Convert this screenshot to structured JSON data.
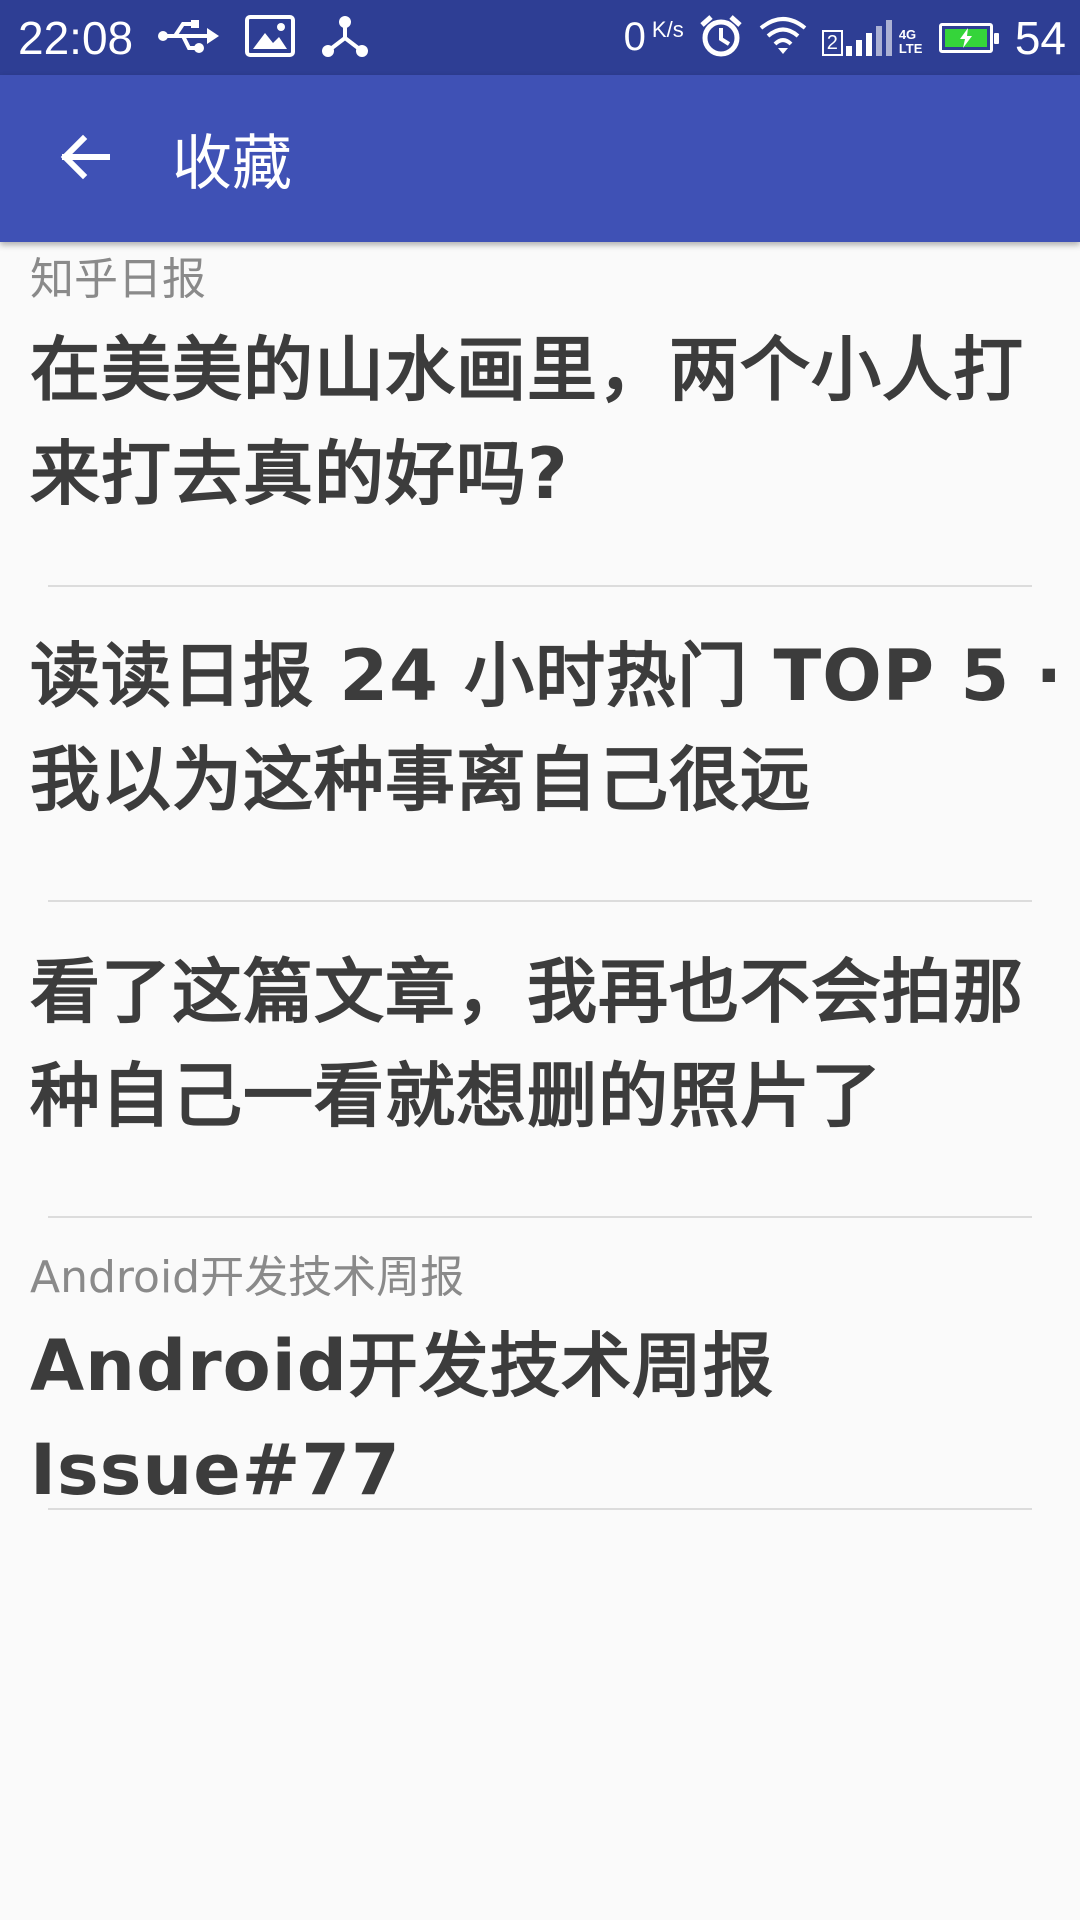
{
  "status_bar": {
    "time": "22:08",
    "speed_value": "0",
    "speed_unit": "K/s",
    "sim_label": "2",
    "network": "4G LTE",
    "battery_percent": "54",
    "icons": [
      "usb-icon",
      "image-icon",
      "share-network-icon",
      "alarm-icon",
      "wifi-icon",
      "signal-icon",
      "battery-charging-icon"
    ]
  },
  "app_bar": {
    "title": "收藏",
    "back_icon": "arrow-back-icon"
  },
  "favorites": [
    {
      "source": "知乎日报",
      "title": "在美美的山水画里，两个小人打来打去真的好吗?"
    },
    {
      "source": "",
      "title": "读读日报 24 小时热门 TOP 5 · 我以为这种事离自己很远"
    },
    {
      "source": "",
      "title": "看了这篇文章，我再也不会拍那种自己一看就想删的照片了"
    },
    {
      "source": "Android开发技术周报",
      "title": "Android开发技术周报 Issue#77"
    }
  ],
  "colors": {
    "status_bar": "#2e3e94",
    "app_bar": "#3f51b5",
    "background": "#fafafa",
    "title_text": "#3c3c3c",
    "source_text": "#8a8a8a",
    "divider": "#dcdcdc"
  }
}
